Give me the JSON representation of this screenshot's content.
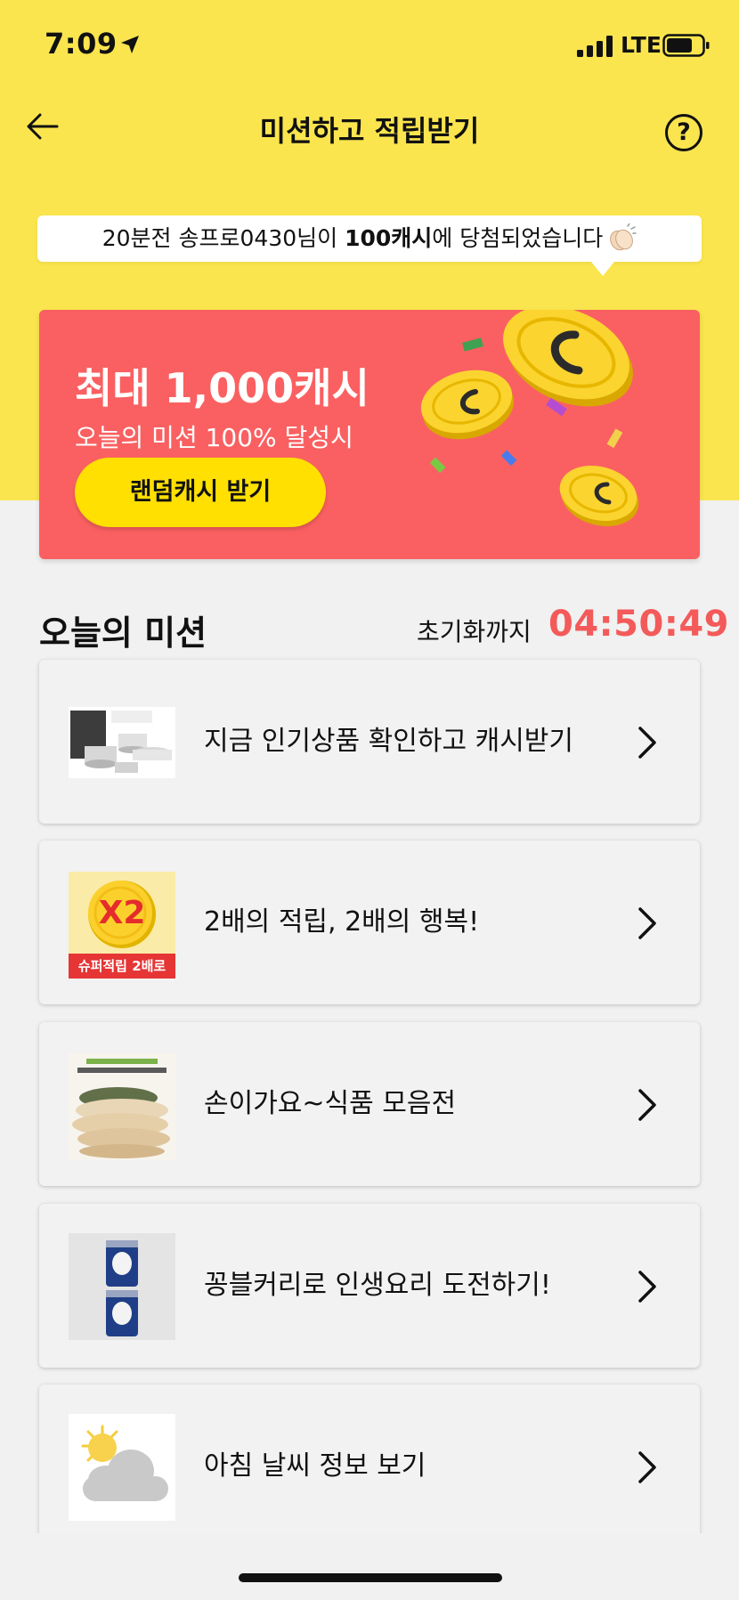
{
  "status_bar": {
    "time": "7:09",
    "network": "LTE"
  },
  "header": {
    "title": "미션하고 적립받기"
  },
  "notice": {
    "prefix": "20분전 송프로0430님이 ",
    "highlight": "100캐시",
    "suffix": "에 당첨되었습니다"
  },
  "promo": {
    "title": "최대 1,000캐시",
    "subtitle": "오늘의 미션 100% 달성시",
    "button_label": "랜덤캐시 받기"
  },
  "missions_section": {
    "title": "오늘의 미션",
    "reset_label": "초기화까지",
    "reset_timer": "04:50:49"
  },
  "missions": [
    {
      "label": "지금 인기상품 확인하고 캐시받기",
      "icon": "cookware-product-icon"
    },
    {
      "label": "2배의 적립, 2배의 행복!",
      "icon": "x2-coin-icon",
      "badge_text": "X2",
      "badge_caption": "슈퍼적립 2배로"
    },
    {
      "label": "손이가요~식품 모음전",
      "icon": "food-product-icon"
    },
    {
      "label": "꽁블커리로 인생요리 도전하기!",
      "icon": "curry-cans-icon"
    },
    {
      "label": "아침 날씨 정보 보기",
      "icon": "weather-icon"
    }
  ],
  "colors": {
    "header_bg": "#fae54e",
    "promo_bg": "#fa6061",
    "promo_button": "#ffe000",
    "timer": "#f45a5a",
    "page_bg": "#f1f1f1"
  }
}
